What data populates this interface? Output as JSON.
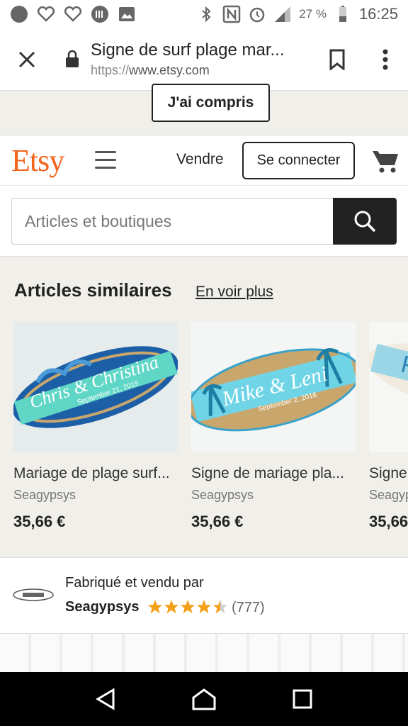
{
  "status_bar": {
    "battery_percent": "27 %",
    "network": "4G",
    "time": "16:25"
  },
  "browser": {
    "title": "Signe de surf plage mar...",
    "url_scheme": "https://",
    "url_host": "www.etsy.com"
  },
  "cookie": {
    "button_label": "J'ai compris"
  },
  "header": {
    "logo": "Etsy",
    "sell_label": "Vendre",
    "signin_label": "Se connecter"
  },
  "search": {
    "placeholder": "Articles et boutiques"
  },
  "similar": {
    "title": "Articles similaires",
    "see_more": "En voir plus",
    "items": [
      {
        "title": "Mariage de plage surf...",
        "shop": "Seagypsys",
        "price": "35,66 €",
        "image_text": "Chris & Christina",
        "image_sub": "September 21, 2015"
      },
      {
        "title": "Signe de mariage pla...",
        "shop": "Seagypsys",
        "price": "35,66 €",
        "image_text": "Mike & Leni",
        "image_sub": "September 2, 2016"
      },
      {
        "title": "Signe",
        "shop": "Seagyp",
        "price": "35,66",
        "image_text": "RYO"
      }
    ]
  },
  "seller": {
    "made_by": "Fabriqué et vendu par",
    "name": "Seagypsys",
    "rating": 4.5,
    "review_count": "(777)"
  },
  "colors": {
    "brand": "#f1641e",
    "star": "#f4a11a",
    "search_button": "#222222"
  }
}
